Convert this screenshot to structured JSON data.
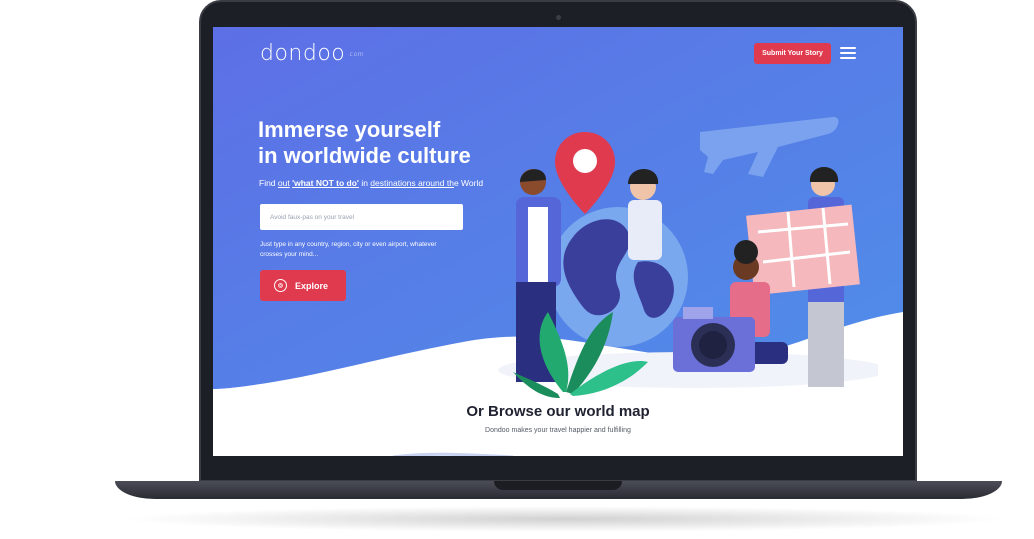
{
  "logo": {
    "text": "dondoo",
    "suffix": ".com"
  },
  "header": {
    "submit_label": "Submit Your Story"
  },
  "hero": {
    "title_line1": "Immerse yourself",
    "title_line2": "in worldwide culture",
    "sub_pre": "Find ",
    "sub_out": "out",
    "sub_what": "'what NOT to do'",
    "sub_mid": " in ",
    "sub_dest": "destinations around th",
    "sub_end": "e World",
    "search_placeholder": "Avoid faux-pas on your travel",
    "hint": "Just type in any country, region, city or even airport, whatever crosses your mind...",
    "explore_label": "Explore"
  },
  "browse": {
    "title": "Or Browse our world map",
    "subtitle": "Dondoo makes your travel happier and fulfilling"
  },
  "colors": {
    "hero_blue": "#5b74e6",
    "accent_red": "#e03a4e",
    "dark_text": "#1f2230"
  }
}
